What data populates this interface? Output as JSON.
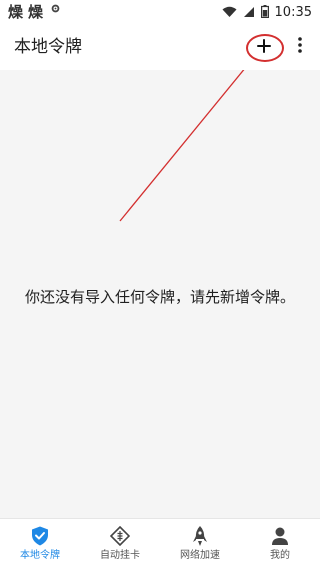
{
  "status_bar": {
    "left_icons": [
      "燥",
      "燥"
    ],
    "extra_icon": "gear-icon",
    "time": "10:35"
  },
  "app_bar": {
    "title": "本地令牌",
    "add_icon": "plus-icon",
    "more_icon": "more-vertical-icon"
  },
  "main": {
    "empty_message": "你还没有导入任何令牌，请先新增令牌。"
  },
  "bottom_nav": {
    "items": [
      {
        "label": "本地令牌",
        "icon": "shield-check-icon",
        "active": true
      },
      {
        "label": "自动挂卡",
        "icon": "card-icon",
        "active": false
      },
      {
        "label": "网络加速",
        "icon": "rocket-icon",
        "active": false
      },
      {
        "label": "我的",
        "icon": "person-icon",
        "active": false
      }
    ]
  },
  "colors": {
    "accent": "#1e88e5",
    "annotation": "#d32f2f",
    "background": "#f5f5f5"
  }
}
